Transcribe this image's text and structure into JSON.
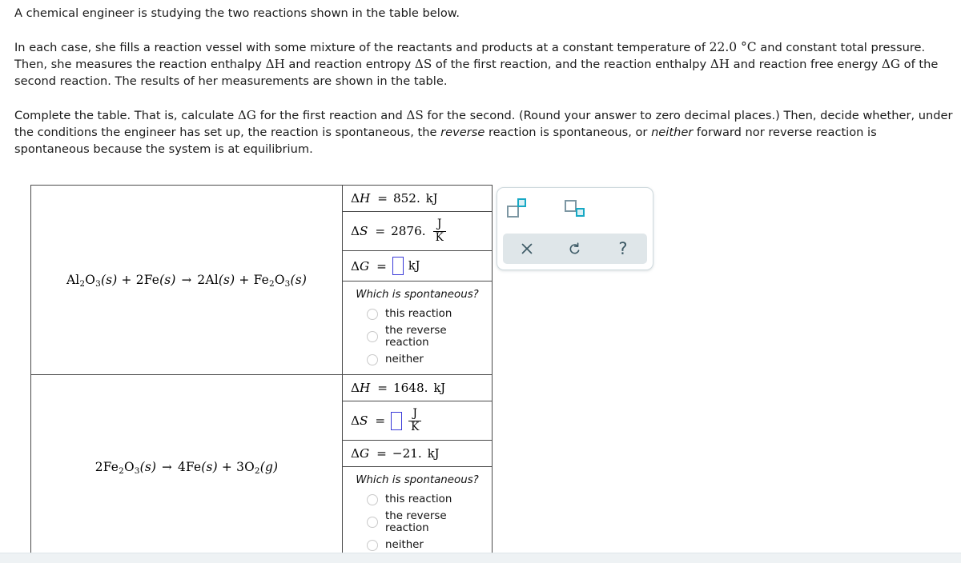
{
  "prompt": {
    "p1": "A chemical engineer is studying the two reactions shown in the table below.",
    "p2_a": "In each case, she fills a reaction vessel with some mixture of the reactants and products at a constant temperature of ",
    "p2_temp": "22.0 °C",
    "p2_b": " and constant total pressure.",
    "p2_c": "Then, she measures the reaction enthalpy ",
    "p2_dh": "ΔH",
    "p2_d": " and reaction entropy ",
    "p2_ds": "ΔS",
    "p2_e": " of the first reaction, and the reaction enthalpy ",
    "p2_dh2": "ΔH",
    "p2_f": " and reaction free energy ",
    "p2_dg": "ΔG",
    "p2_g": " of the second reaction. The results of her measurements are shown in the table.",
    "p3_a": "Complete the table. That is, calculate ",
    "p3_dg": "ΔG",
    "p3_b": " for the first reaction and ",
    "p3_ds": "ΔS",
    "p3_c": " for the second. (Round your answer to zero decimal places.) Then, decide whether, under the conditions the engineer has set up, the reaction is spontaneous, the ",
    "p3_reverse": "reverse",
    "p3_d": " reaction is spontaneous, or ",
    "p3_neither": "neither",
    "p3_e": " forward nor reverse reaction is spontaneous because the system is at equilibrium."
  },
  "table": {
    "spontaneity_question": "Which is spontaneous?",
    "options": [
      "this reaction",
      "the reverse reaction",
      "neither"
    ],
    "rows": [
      {
        "equation": {
          "reactants": "Al₂O₃(s) + 2Fe(s)",
          "arrow": "→",
          "products": "2Al(s) + Fe₂O₃(s)",
          "plain": "Al2O3(s) + 2Fe(s) → 2Al(s) + Fe2O3(s)"
        },
        "dH": {
          "label": "ΔH",
          "eq": "=",
          "value": "852.",
          "unit": "kJ"
        },
        "dS": {
          "label": "ΔS",
          "eq": "=",
          "value": "2876.",
          "unit_num": "J",
          "unit_den": "K"
        },
        "dG": {
          "label": "ΔG",
          "eq": "=",
          "value": "",
          "unit": "kJ",
          "is_input": true
        }
      },
      {
        "equation": {
          "reactants": "2Fe₂O₃(s)",
          "arrow": "→",
          "products": "4Fe(s) + 3O₂(g)",
          "plain": "2Fe2O3(s) → 4Fe(s) + 3O2(g)"
        },
        "dH": {
          "label": "ΔH",
          "eq": "=",
          "value": "1648.",
          "unit": "kJ"
        },
        "dS": {
          "label": "ΔS",
          "eq": "=",
          "value": "",
          "unit_num": "J",
          "unit_den": "K",
          "is_input": true
        },
        "dG": {
          "label": "ΔG",
          "eq": "=",
          "value": "−21.",
          "unit": "kJ"
        }
      }
    ]
  },
  "palette": {
    "superscript_label": "superscript",
    "subscript_label": "subscript",
    "clear_label": "×",
    "undo_label": "undo",
    "help_label": "?",
    "accent_color": "#17a8c4",
    "frame_color": "#7d97a3",
    "bar_color": "#dfe6e9",
    "icon_color": "#3d5a66"
  }
}
